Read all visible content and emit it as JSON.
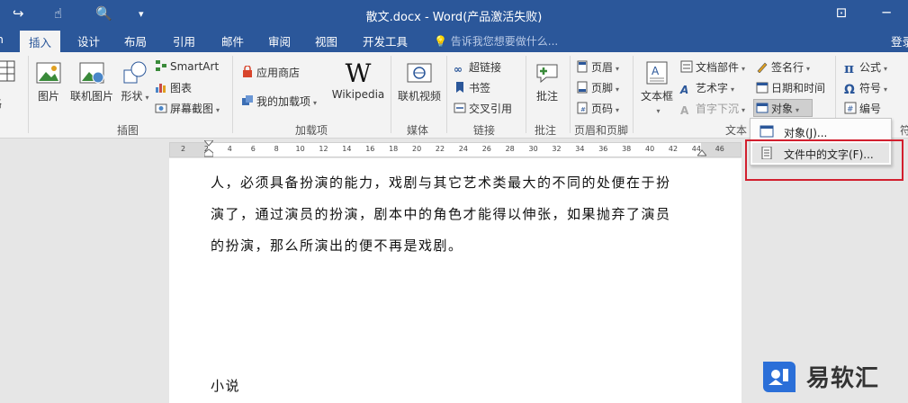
{
  "title_bar": {
    "title": "散文.docx - Word(产品激活失败)",
    "undo_icon": "redo-icon",
    "minimize_icon": "ribbon-display-icon",
    "close_icon": "close-icon"
  },
  "tabs": [
    "插入",
    "设计",
    "布局",
    "引用",
    "邮件",
    "审阅",
    "视图",
    "开发工具"
  ],
  "tab_partial_left": "",
  "active_tab": "插入",
  "tell_me": "告诉我您想要做什么...",
  "sign_in": "登录",
  "ribbon": {
    "table_partial": "表格",
    "illustrations": {
      "picture": "图片",
      "online_picture": "联机图片",
      "shapes": "形状",
      "smartart": "SmartArt",
      "chart": "图表",
      "screenshot": "屏幕截图",
      "group": "插图"
    },
    "addins": {
      "store": "应用商店",
      "my_addins": "我的加载项",
      "wikipedia": "Wikipedia",
      "group": "加载项"
    },
    "media": {
      "online_video": "联机视频",
      "group": "媒体"
    },
    "links": {
      "hyperlink": "超链接",
      "bookmark": "书签",
      "cross_ref": "交叉引用",
      "group": "链接"
    },
    "comments": {
      "comment": "批注",
      "group": "批注"
    },
    "header_footer": {
      "header": "页眉",
      "footer": "页脚",
      "page_number": "页码",
      "group": "页眉和页脚"
    },
    "text": {
      "textbox": "文本框",
      "quick_parts": "文档部件",
      "wordart": "艺术字",
      "dropcap": "首字下沉",
      "signature": "签名行",
      "datetime": "日期和时间",
      "object": "对象",
      "group": "文本"
    },
    "symbols": {
      "equation": "公式",
      "symbol": "符号",
      "number": "编号",
      "group_partial": "符"
    }
  },
  "ruler_ticks": [
    "2",
    "2",
    "4",
    "6",
    "8",
    "10",
    "12",
    "14",
    "16",
    "18",
    "20",
    "22",
    "24",
    "26",
    "28",
    "30",
    "32",
    "34",
    "36",
    "38",
    "40",
    "42",
    "44",
    "46"
  ],
  "document": {
    "lines": [
      "人，必须具备扮演的能力，戏剧与其它艺术类最大的不同的处便在于扮",
      "演了，通过演员的扮演，剧本中的角色才能得以伸张，如果抛弃了演员",
      "的扮演，那么所演出的便不再是戏剧。"
    ],
    "heading": "小说"
  },
  "object_menu": {
    "items": [
      "对象(J)...",
      "文件中的文字(F)..."
    ],
    "highlighted_index": 1
  },
  "watermark": {
    "text": "易软汇"
  },
  "colors": {
    "accent": "#2b579a",
    "highlight_box": "#d21f2e"
  }
}
